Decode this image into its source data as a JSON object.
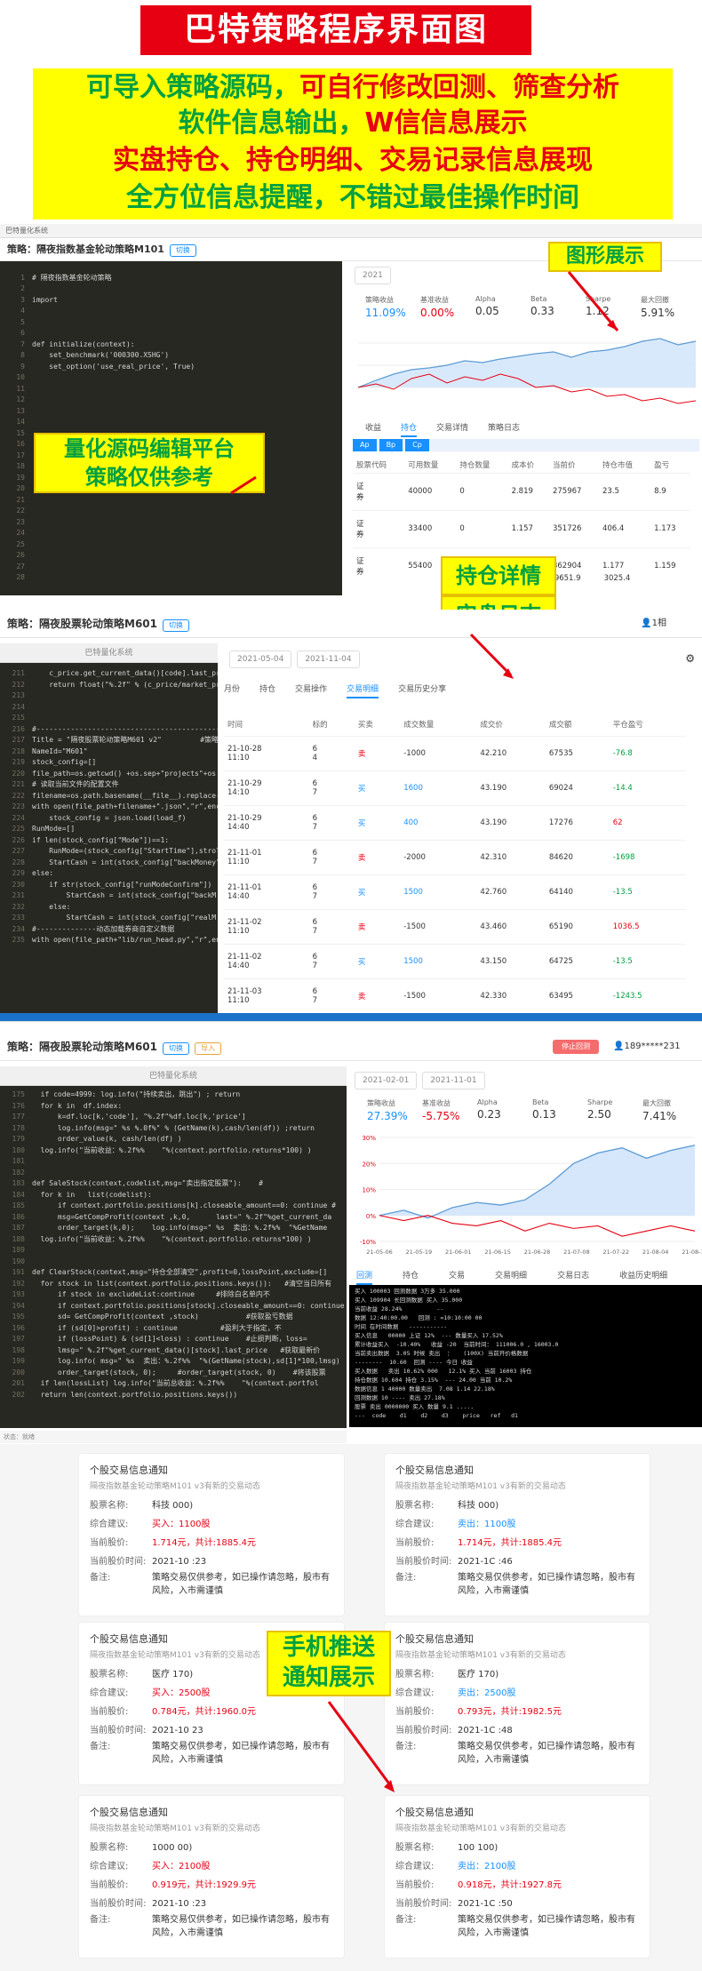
{
  "banner": {
    "title": "巴特策略程序界面图",
    "line1a": "可导入策略源码，",
    "line1b": "可自行修改回测、筛查分析",
    "line2a": "软件信息输出，",
    "line2b": "W信信息展示",
    "line3": "实盘持仓、持仓明细、交易记录信息展现",
    "line4": "全方位信息提醒，不错过最佳操作时间"
  },
  "callouts": {
    "chart": "图形展示",
    "editor1": "量化源码编辑平台",
    "editor2": "策略仅供参考",
    "position1": "持仓详情",
    "position2": "实盘日志",
    "push1": "手机推送",
    "push2": "通知展示"
  },
  "panel1": {
    "strategy": "策略：隔夜指数基金轮动策略M101",
    "btn": "切换",
    "metrics": [
      {
        "label": "策略收益",
        "value": "11.09%",
        "color": "#1890ff"
      },
      {
        "label": "基准收益",
        "value": "0.00%",
        "color": "#e60012"
      },
      {
        "label": "Alpha",
        "value": "0.05",
        "color": "#333"
      },
      {
        "label": "Beta",
        "value": "0.33",
        "color": "#333"
      },
      {
        "label": "Sharpe",
        "value": "1.12",
        "color": "#333"
      },
      {
        "label": "最大回撤",
        "value": "5.91%",
        "color": "#333"
      }
    ],
    "tabs": [
      "收益",
      "持仓",
      "交易详情",
      "策略日志"
    ],
    "subtabs": [
      "Ap",
      "Bp",
      "Cp"
    ],
    "head": [
      "股票代码",
      "可用数量",
      "持仓数量",
      "成本价",
      "当前价",
      "持仓市值",
      "盈亏"
    ],
    "rows": [
      [
        "证\n券",
        "40000",
        "0",
        "2.819",
        "275967",
        "23.5",
        "8.9"
      ],
      [
        "证\n券",
        "33400",
        "0",
        "1.157",
        "351726",
        "406.4",
        "1.173"
      ],
      [
        "证\n券",
        "55400",
        "0",
        "1.521",
        "362904",
        "1.177",
        "1.159"
      ]
    ],
    "total1": "939651.9",
    "total2": "3025.4"
  },
  "panel2": {
    "strategy": "策略：隔夜股票轮动策略M601",
    "btn": "切换",
    "date_from": "2021-05-04",
    "date_to": "2021-11-04",
    "user": "1相",
    "editor_head": "巴特量化系统",
    "tabs": [
      "月份",
      "持仓",
      "交易操作",
      "交易明细",
      "交易历史分享"
    ],
    "head": [
      "时间",
      "标的",
      "买卖",
      "成交数量",
      "成交价",
      "成交额",
      "平仓盈亏"
    ],
    "rows": [
      [
        "21-10-28\n11:10",
        "6\n4",
        "卖",
        "-1000",
        "42.210",
        "67535",
        "-76.8"
      ],
      [
        "21-10-29\n14:10",
        "6\n7",
        "买",
        "1600",
        "43.190",
        "69024",
        "-14.4"
      ],
      [
        "21-10-29\n14:40",
        "6\n7",
        "买",
        "400",
        "43.190",
        "17276",
        "62"
      ],
      [
        "21-11-01\n11:10",
        "6\n7",
        "卖",
        "-2000",
        "42.310",
        "84620",
        "-1698"
      ],
      [
        "21-11-01\n14:40",
        "6\n7",
        "买",
        "1500",
        "42.760",
        "64140",
        "-13.5"
      ],
      [
        "21-11-02\n11:10",
        "6\n7",
        "卖",
        "-1500",
        "43.460",
        "65190",
        "1036.5"
      ],
      [
        "21-11-02\n14:40",
        "6\n7",
        "买",
        "1500",
        "43.150",
        "64725",
        "-13.5"
      ],
      [
        "21-11-03\n11:10",
        "6\n7",
        "卖",
        "-1500",
        "42.330",
        "63495",
        "-1243.5"
      ]
    ],
    "code": [
      [
        "211",
        "    c_price.get_current_data()[code].last_pri"
      ],
      [
        "212",
        "    return float(\"%.2f\" % (c_price/market_pri"
      ],
      [
        "213",
        ""
      ],
      [
        "214",
        ""
      ],
      [
        "215",
        ""
      ],
      [
        "216",
        "#--------------------------------------------"
      ],
      [
        "217",
        "Title = \"隔夜股票轮动策略M601 v2\"         #策略"
      ],
      [
        "218",
        "NameId=\"M601\""
      ],
      [
        "219",
        "stock_config=[]"
      ],
      [
        "220",
        "file_path=os.getcwd() +os.sep+\"projects\"+os"
      ],
      [
        "221",
        "# 读取当前文件的配置文件"
      ],
      [
        "222",
        "filename=os.path.basename(__file__).replace("
      ],
      [
        "223",
        "with open(file_path+filename+\".json\",\"r\",enco"
      ],
      [
        "224",
        "    stock_config = json.load(load_f)"
      ],
      [
        "225",
        "RunMode=[]"
      ],
      [
        "226",
        "if len(stock_config[\"Mode\"])==1:"
      ],
      [
        "227",
        "    RunMode=(stock_config[\"StartTime\"],strold"
      ],
      [
        "228",
        "    StartCash = int(stock_config[\"backMoney\"]"
      ],
      [
        "229",
        "else:"
      ],
      [
        "230",
        "    if str(stock_config[\"runModeConfirm\"])"
      ],
      [
        "231",
        "        StartCash = int(stock_config[\"backM"
      ],
      [
        "232",
        "    else:"
      ],
      [
        "233",
        "        StartCash = int(stock_config[\"realM"
      ],
      [
        "234",
        "#--------------动态加载券商自定义数据"
      ],
      [
        "235",
        "with open(file_path+\"lib/run_head.py\",\"r\",enc"
      ]
    ]
  },
  "panel3": {
    "strategy": "策略：隔夜股票轮动策略M601",
    "btn1": "切换",
    "btn2": "导入",
    "stop": "停止回测",
    "user": "189*****231",
    "editor_head": "巴特量化系统",
    "date_from": "2021-02-01",
    "date_to": "2021-11-01",
    "metrics": [
      {
        "label": "策略收益",
        "value": "27.39%",
        "color": "#1890ff"
      },
      {
        "label": "基准收益",
        "value": "-5.75%",
        "color": "#e60012"
      },
      {
        "label": "Alpha",
        "value": "0.23",
        "color": "#333"
      },
      {
        "label": "Beta",
        "value": "0.13",
        "color": "#333"
      },
      {
        "label": "Sharpe",
        "value": "2.50",
        "color": "#333"
      },
      {
        "label": "最大回撤",
        "value": "7.41%",
        "color": "#333"
      }
    ],
    "xaxis": [
      "21-05-06",
      "21-05-19",
      "21-06-01",
      "21-06-15",
      "21-06-28",
      "21-07-08",
      "21-07-22",
      "21-08-04",
      "21-08-17"
    ],
    "yaxis": [
      "30%",
      "20%",
      "10%",
      "0%",
      "-10%"
    ],
    "tabs": [
      "回测",
      "持仓",
      "交易",
      "交易明细",
      "交易日志",
      "收益历史明细"
    ],
    "code": [
      [
        "175",
        "  if code=4999: log.info(\"持续卖出，跳出\") ; return"
      ],
      [
        "176",
        "  for k in  df.index:"
      ],
      [
        "177",
        "      k=df.loc[k,'code'], \"%.2f\"%df.loc[k,'price']"
      ],
      [
        "178",
        "      log.info(msg=\" %s %.0f%\" % (GetName(k),cash/len(df)) ;return"
      ],
      [
        "179",
        "      order_value(k, cash/len(df) )"
      ],
      [
        "180",
        "  log.info(\"当前收益：%.2f%%    \"%(context.portfolio.returns*100) )"
      ],
      [
        "181",
        ""
      ],
      [
        "182",
        ""
      ],
      [
        "183",
        "def SaleStock(context,codelist,msg=\"卖出指定股票\"):    #"
      ],
      [
        "184",
        "  for k in   list(codelist):"
      ],
      [
        "185",
        "      if context.portfolio.positions[k].closeable_amount==0: continue #"
      ],
      [
        "186",
        "      msg=GetCompProfit(context ,k,0,      last=\" %.2f\"%get_current_da"
      ],
      [
        "187",
        "      order_target(k,0);    log.info(msg=\" %s  卖出：%.2f%%  \"%GetName"
      ],
      [
        "188",
        "  log.info(\"当前收益：%.2f%%    \"%(context.portfolio.returns*100) )"
      ],
      [
        "189",
        ""
      ],
      [
        "190",
        ""
      ],
      [
        "191",
        "def ClearStock(context,msg=\"持仓全部清空\",profit=0,lossPoint,exclude=[]"
      ],
      [
        "192",
        "  for stock in list(context.portfolio.positions.keys()):   #清空当日所有"
      ],
      [
        "193",
        "      if stock in excludeList:continue     #排除白名单内不"
      ],
      [
        "194",
        "      if context.portfolio.positions[stock].closeable_amount==0: continue"
      ],
      [
        "195",
        "      sd= GetCompProfit(context ,stock)           #获取盈亏数据"
      ],
      [
        "196",
        "      if (sd[0]>profit) : continue          #盈利大于指定，不"
      ],
      [
        "197",
        "      if (lossPoint) & (sd[1]<loss) : continue    #止损判断，loss="
      ],
      [
        "198",
        "      lmsg=\" %.2f\"%get_current_data()[stock].last_price   #获取最新价"
      ],
      [
        "199",
        "      log.info( msg=\" %s  卖出：%.2f%%  \"%(GetName(stock),sd[1]*100,lmsg)"
      ],
      [
        "200",
        "      order_target(stock, 0);     #order_target(stock, 0)    #将该股票"
      ],
      [
        "201",
        "  if len(lossList) log.info(\"当前总收益：%.2f%%    \"%(context.portfol"
      ],
      [
        "202",
        "  return len(context.portfolio.positions.keys())"
      ]
    ],
    "log": [
      "买入 100003 回测数据 3万多 35.000",
      "买入 109904 长回测数据 买入 35.000",
      "当前收益 28.24%          --",
      "数据 12:40:00.00   回测 : =10:10:00 00",
      "时间 在时间数据   -----------",
      "买入信息   00000 上证 12%  --- 数量买入 17.52%",
      "累计收益买入  -10.40%   收益 -20  当前时间： 111006.0 , 16003.0",
      "当前卖出数据  3.05 时候 卖出  ：   (100X) 当前开价格数据",
      "--------  10.60  回测 ---- 今日 收益",
      "买入数据   卖出 10.62% 000   12.1% 买入 当前 16003 持仓",
      "持仓数据 10.604 持仓 3.15%  --- 24.00 当前 10.2%",
      "数据信息 1 40000 数量卖出  7.08 1.14 22.18%",
      "回测数据 10 ---- 卖出 27.18%",
      "股票 卖出 0000000 买入 数量 9.1 .....",
      "---  code    d1    d2    d3    price   ref   d1"
    ]
  },
  "notices": [
    {
      "title": "个股交易信息通知",
      "sub": "隔夜指数基金轮动策略M101 v3有新的交易动态",
      "name": "科技        000)",
      "advice": "买入：1100股",
      "price": "1.714元，共计:1885.4元",
      "time": "2021-10         :23",
      "note": "策略交易仅供参考，如已操作请忽略，股市有风险，入市需谨慎",
      "advice_color": "#e60012"
    },
    {
      "title": "个股交易信息通知",
      "sub": "隔夜指数基金轮动策略M101 v3有新的交易动态",
      "name": "科技        000)",
      "advice": "卖出：1100股",
      "price": "1.714元，共计:1885.4元",
      "time": "2021-1C          :46",
      "note": "策略交易仅供参考，如已操作请忽略，股市有风险，入市需谨慎",
      "advice_color": "#1890ff"
    },
    {
      "title": "个股交易信息通知",
      "sub": "隔夜指数基金轮动策略M101 v3有新的交易动态",
      "name": "医疗         170)",
      "advice": "买入：2500股",
      "price": "0.784元，共计:1960.0元",
      "time": "2021-10          23",
      "note": "策略交易仅供参考，如已操作请忽略，股市有风险，入市需谨慎",
      "advice_color": "#e60012"
    },
    {
      "title": "个股交易信息通知",
      "sub": "隔夜指数基金轮动策略M101 v3有新的交易动态",
      "name": "医疗         170)",
      "advice": "卖出：2500股",
      "price": "0.793元，共计:1982.5元",
      "time": "2021-1C          :48",
      "note": "策略交易仅供参考，如已操作请忽略，股市有风险，入市需谨慎",
      "advice_color": "#1890ff"
    },
    {
      "title": "个股交易信息通知",
      "sub": "隔夜指数基金轮动策略M101 v3有新的交易动态",
      "name": "1000         00)",
      "advice": "买入：2100股",
      "price": "0.919元，共计:1929.9元",
      "time": "2021-10          :23",
      "note": "策略交易仅供参考，如已操作请忽略，股市有风险，入市需谨慎",
      "advice_color": "#e60012"
    },
    {
      "title": "个股交易信息通知",
      "sub": "隔夜指数基金轮动策略M101 v3有新的交易动态",
      "name": "100          100)",
      "advice": "卖出：2100股",
      "price": "0.918元，共计:1927.8元",
      "time": "2021-1C          :50",
      "note": "策略交易仅供参考，如已操作请忽略，股市有风险，入市需谨慎",
      "advice_color": "#1890ff"
    }
  ],
  "notice_labels": {
    "name": "股票名称:",
    "advice": "综合建议:",
    "price": "当前股价:",
    "time": "当前股价时间:",
    "note": "备注:"
  },
  "chart_data": {
    "type": "line",
    "x": [
      "21-05-06",
      "21-05-19",
      "21-06-01",
      "21-06-15",
      "21-06-28",
      "21-07-08",
      "21-07-22",
      "21-08-04",
      "21-08-17"
    ],
    "series": [
      {
        "name": "策略收益",
        "values": [
          0,
          2,
          -1,
          3,
          5,
          4,
          6,
          12,
          20,
          24,
          26,
          22,
          25,
          27
        ]
      },
      {
        "name": "基准收益",
        "values": [
          0,
          -2,
          0,
          -3,
          -4,
          -2,
          -6,
          -3,
          -5,
          -4,
          -8,
          -6,
          -4,
          -6
        ]
      }
    ],
    "ylim": [
      -10,
      30
    ]
  }
}
